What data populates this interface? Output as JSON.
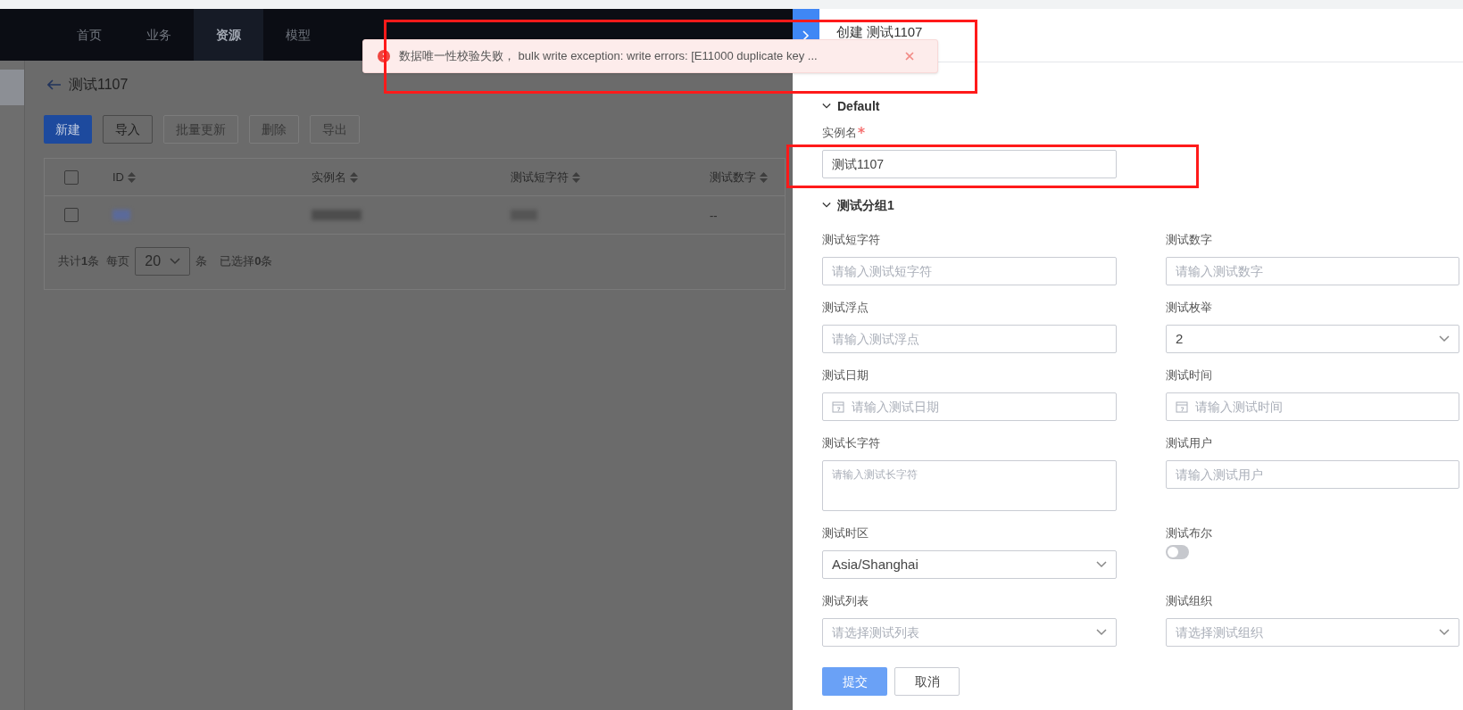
{
  "nav": {
    "items": [
      {
        "label": "首页",
        "selected": false
      },
      {
        "label": "业务",
        "selected": false
      },
      {
        "label": "资源",
        "selected": true
      },
      {
        "label": "模型",
        "selected": false
      }
    ]
  },
  "page": {
    "title": "测试1107",
    "toolbar": [
      {
        "label": "新建",
        "kind": "primary",
        "disabled": false
      },
      {
        "label": "导入",
        "kind": "default",
        "disabled": false
      },
      {
        "label": "批量更新",
        "kind": "default",
        "disabled": true
      },
      {
        "label": "删除",
        "kind": "default",
        "disabled": true
      },
      {
        "label": "导出",
        "kind": "default",
        "disabled": true
      }
    ],
    "table": {
      "all_selected": false,
      "columns": [
        "ID",
        "实例名",
        "测试短字符",
        "测试数字"
      ],
      "rows": [
        {
          "selected": false,
          "cells": [
            {
              "kind": "redacted"
            },
            {
              "kind": "redacted"
            },
            {
              "kind": "redacted"
            },
            {
              "kind": "text",
              "text": "--"
            }
          ]
        }
      ]
    },
    "pagination": {
      "total": "共计**1**条",
      "per_page_label": "每页",
      "page_size": "20",
      "per_page_suffix": "条",
      "selected": "已选择**0**条"
    }
  },
  "toast": {
    "kind": "error",
    "message": "数据唯一性校验失败， bulk write exception: write errors: [E11000 duplicate key ..."
  },
  "drawer": {
    "title": "创建 测试1107",
    "sections": [
      {
        "title": "Default",
        "expanded": true,
        "fields": [
          {
            "label": "实例名",
            "required": true,
            "kind": "text",
            "value": "测试1107"
          }
        ]
      },
      {
        "title": "测试分组1",
        "expanded": true,
        "fields": [
          {
            "label": "测试短字符",
            "required": false,
            "kind": "text",
            "placeholder": "请输入测试短字符"
          },
          {
            "label": "测试数字",
            "required": false,
            "kind": "text",
            "placeholder": "请输入测试数字"
          },
          {
            "label": "测试浮点",
            "required": false,
            "kind": "text",
            "placeholder": "请输入测试浮点"
          },
          {
            "label": "测试枚举",
            "required": false,
            "kind": "select",
            "value": "2"
          },
          {
            "label": "测试日期",
            "required": false,
            "kind": "date",
            "placeholder": "请输入测试日期"
          },
          {
            "label": "测试时间",
            "required": false,
            "kind": "date",
            "placeholder": "请输入测试时间"
          },
          {
            "label": "测试长字符",
            "required": false,
            "kind": "textarea",
            "placeholder": "请输入测试长字符"
          },
          {
            "label": "测试用户",
            "required": false,
            "kind": "text",
            "placeholder": "请输入测试用户"
          },
          {
            "label": "测试时区",
            "required": false,
            "kind": "select",
            "value": "Asia/Shanghai"
          },
          {
            "label": "测试布尔",
            "required": false,
            "kind": "switch",
            "on": false
          },
          {
            "label": "测试列表",
            "required": false,
            "kind": "select",
            "placeholder": "请选择测试列表"
          },
          {
            "label": "测试组织",
            "required": false,
            "kind": "select",
            "placeholder": "请选择测试组织"
          }
        ]
      }
    ],
    "buttons": [
      {
        "label": "提交",
        "kind": "primary"
      },
      {
        "label": "取消",
        "kind": "default"
      }
    ]
  }
}
